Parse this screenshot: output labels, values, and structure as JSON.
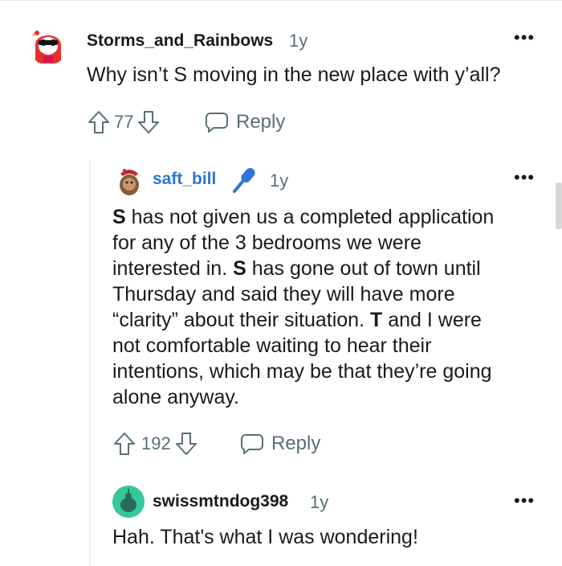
{
  "comments": [
    {
      "username": "Storms_and_Rainbows",
      "age": "1y",
      "text": "Why isn’t S moving in the new place with y’all?",
      "votes": "77",
      "reply_label": "Reply",
      "avatar_color": "#e5312b"
    },
    {
      "username": "saft_bill",
      "username_color": "#2e75d6",
      "badge_icon": "microphone-icon",
      "age": "1y",
      "lines": [
        [
          {
            "b": "S"
          },
          {
            "t": " has not given us a completed application"
          }
        ],
        [
          {
            "t": "for any of the 3 bedrooms we were"
          }
        ],
        [
          {
            "t": "interested in. "
          },
          {
            "b": "S"
          },
          {
            "t": " has gone out of town until"
          }
        ],
        [
          {
            "t": "Thursday and said they will have more"
          }
        ],
        [
          {
            "t": "“clarity” about their situation. "
          },
          {
            "b": "T"
          },
          {
            "t": " and I were"
          }
        ],
        [
          {
            "t": "not comfortable waiting to hear their"
          }
        ],
        [
          {
            "t": "intentions, which may be that they’re going"
          }
        ],
        [
          {
            "t": "alone anyway."
          }
        ]
      ],
      "votes": "192",
      "reply_label": "Reply",
      "avatar_color": "#8a5a3a"
    },
    {
      "username": "swissmtndog398",
      "age": "1y",
      "text": "Hah. That's what I was wondering!",
      "avatar_color": "#36c79a"
    }
  ]
}
